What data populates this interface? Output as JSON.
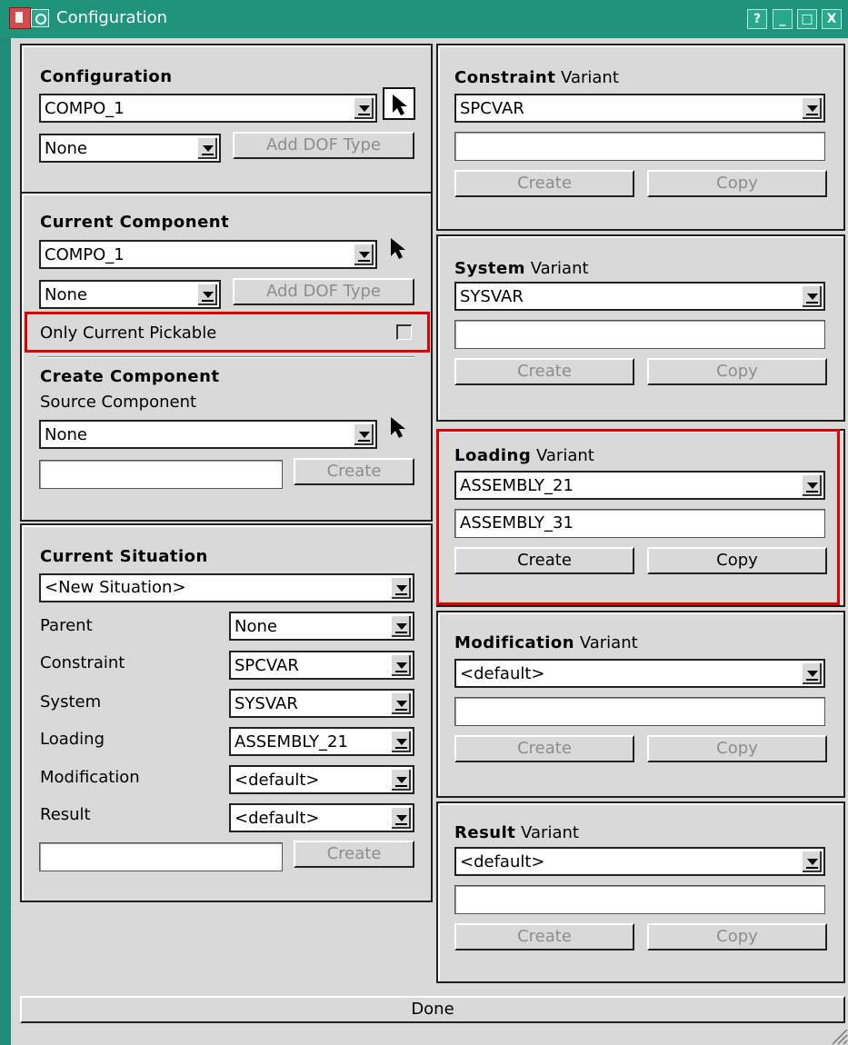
{
  "window": {
    "title": "Configuration",
    "buttons": {
      "help": "?",
      "minimize": "_",
      "maximize": "□",
      "close": "X"
    }
  },
  "config": {
    "title": "Configuration",
    "combo": "COMPO_1",
    "dof_combo": "None",
    "add_dof": "Add DOF Type"
  },
  "current_component": {
    "title": "Current Component",
    "combo": "COMPO_1",
    "dof_combo": "None",
    "add_dof": "Add DOF Type",
    "only_pickable": "Only Current Pickable",
    "only_pickable_checked": false
  },
  "create_component": {
    "title": "Create Component",
    "source_label": "Source Component",
    "source_combo": "None",
    "name_value": "",
    "create": "Create"
  },
  "situation": {
    "title": "Current Situation",
    "combo": "<New Situation>",
    "rows": [
      {
        "label": "Parent",
        "value": "None"
      },
      {
        "label": "Constraint",
        "value": "SPCVAR"
      },
      {
        "label": "System",
        "value": "SYSVAR"
      },
      {
        "label": "Loading",
        "value": "ASSEMBLY_21"
      },
      {
        "label": "Modification",
        "value": "<default>"
      },
      {
        "label": "Result",
        "value": "<default>"
      }
    ],
    "name_value": "",
    "create": "Create"
  },
  "variants": [
    {
      "bold": "Constraint",
      "suffix": " Variant",
      "combo": "SPCVAR",
      "field": "",
      "create": "Create",
      "copy": "Copy",
      "enabled": false
    },
    {
      "bold": "System",
      "suffix": " Variant",
      "combo": "SYSVAR",
      "field": "",
      "create": "Create",
      "copy": "Copy",
      "enabled": false
    },
    {
      "bold": "Loading",
      "suffix": " Variant",
      "combo": "ASSEMBLY_21",
      "field": "ASSEMBLY_31",
      "create": "Create",
      "copy": "Copy",
      "enabled": true
    },
    {
      "bold": "Modification",
      "suffix": " Variant",
      "combo": "<default>",
      "field": "",
      "create": "Create",
      "copy": "Copy",
      "enabled": false
    },
    {
      "bold": "Result",
      "suffix": " Variant",
      "combo": "<default>",
      "field": "",
      "create": "Create",
      "copy": "Copy",
      "enabled": false
    }
  ],
  "done": "Done",
  "icons": [
    "app-icon",
    "window-menu-icon",
    "arrow-picker-icon",
    "dropdown-arrow-icon",
    "resize-grip-icon"
  ],
  "colors": {
    "titlebar": "#20937b",
    "highlight": "#e00000",
    "panel": "#d9d9d9"
  }
}
